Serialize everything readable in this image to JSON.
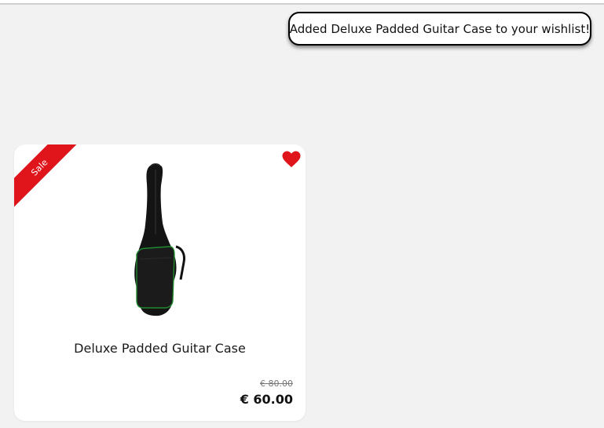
{
  "toast": {
    "message": "Added Deluxe Padded Guitar Case to your wishlist!"
  },
  "product": {
    "badge": "Sale",
    "name": "Deluxe Padded Guitar Case",
    "old_price": "€ 80.00",
    "price": "€ 60.00",
    "wishlisted": true,
    "image_icon": "guitar-gig-bag"
  },
  "colors": {
    "badge": "#e0151b",
    "heart": "#e0151b",
    "accent_trim": "#1f8a2e",
    "background": "#f2f2f2"
  }
}
